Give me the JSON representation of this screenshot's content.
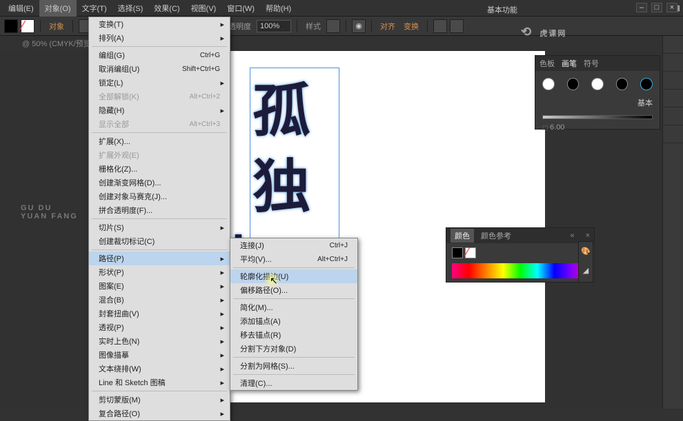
{
  "menubar": [
    "编辑(E)",
    "对象(O)",
    "文字(T)",
    "选择(S)",
    "效果(C)",
    "视图(V)",
    "窗口(W)",
    "帮助(H)"
  ],
  "menubar_active_index": 1,
  "right_header": "基本功能",
  "toolrow": {
    "obj_label": "对象",
    "basic_label": "基本",
    "opacity_label": "不透明度",
    "opacity_value": "100%",
    "style_label": "样式",
    "align_label": "对齐",
    "transform_label": "变换"
  },
  "doc_label": "@ 50% (CMYK/预览)",
  "canvas_side_text": {
    "line1": "GU DU",
    "line2": "YUAN FANG"
  },
  "dropdown": [
    {
      "type": "row",
      "label": "变换(T)",
      "arrow": true
    },
    {
      "type": "row",
      "label": "排列(A)",
      "arrow": true
    },
    {
      "type": "sep"
    },
    {
      "type": "row",
      "label": "编组(G)",
      "short": "Ctrl+G"
    },
    {
      "type": "row",
      "label": "取消编组(U)",
      "short": "Shift+Ctrl+G"
    },
    {
      "type": "row",
      "label": "锁定(L)",
      "arrow": true
    },
    {
      "type": "row",
      "label": "全部解锁(K)",
      "short": "Alt+Ctrl+2",
      "disabled": true
    },
    {
      "type": "row",
      "label": "隐藏(H)",
      "arrow": true
    },
    {
      "type": "row",
      "label": "显示全部",
      "short": "Alt+Ctrl+3",
      "disabled": true
    },
    {
      "type": "sep"
    },
    {
      "type": "row",
      "label": "扩展(X)..."
    },
    {
      "type": "row",
      "label": "扩展外观(E)",
      "disabled": true
    },
    {
      "type": "row",
      "label": "栅格化(Z)..."
    },
    {
      "type": "row",
      "label": "创建渐变网格(D)..."
    },
    {
      "type": "row",
      "label": "创建对象马赛克(J)..."
    },
    {
      "type": "row",
      "label": "拼合透明度(F)..."
    },
    {
      "type": "sep"
    },
    {
      "type": "row",
      "label": "切片(S)",
      "arrow": true
    },
    {
      "type": "row",
      "label": "创建裁切标记(C)"
    },
    {
      "type": "sep"
    },
    {
      "type": "row",
      "label": "路径(P)",
      "arrow": true,
      "hover": true
    },
    {
      "type": "row",
      "label": "形状(P)",
      "arrow": true
    },
    {
      "type": "row",
      "label": "图案(E)",
      "arrow": true
    },
    {
      "type": "row",
      "label": "混合(B)",
      "arrow": true
    },
    {
      "type": "row",
      "label": "封套扭曲(V)",
      "arrow": true
    },
    {
      "type": "row",
      "label": "透视(P)",
      "arrow": true
    },
    {
      "type": "row",
      "label": "实时上色(N)",
      "arrow": true
    },
    {
      "type": "row",
      "label": "图像描摹",
      "arrow": true
    },
    {
      "type": "row",
      "label": "文本绕排(W)",
      "arrow": true
    },
    {
      "type": "row",
      "label": "Line 和 Sketch 图稿",
      "arrow": true
    },
    {
      "type": "sep"
    },
    {
      "type": "row",
      "label": "剪切蒙版(M)",
      "arrow": true
    },
    {
      "type": "row",
      "label": "复合路径(O)",
      "arrow": true
    }
  ],
  "submenu": [
    {
      "type": "row",
      "label": "连接(J)",
      "short": "Ctrl+J"
    },
    {
      "type": "row",
      "label": "平均(V)...",
      "short": "Alt+Ctrl+J"
    },
    {
      "type": "sep"
    },
    {
      "type": "row",
      "label": "轮廓化描边(U)",
      "hover": true
    },
    {
      "type": "row",
      "label": "偏移路径(O)..."
    },
    {
      "type": "sep"
    },
    {
      "type": "row",
      "label": "简化(M)..."
    },
    {
      "type": "row",
      "label": "添加锚点(A)"
    },
    {
      "type": "row",
      "label": "移去锚点(R)"
    },
    {
      "type": "row",
      "label": "分割下方对象(D)"
    },
    {
      "type": "sep"
    },
    {
      "type": "row",
      "label": "分割为网格(S)..."
    },
    {
      "type": "sep"
    },
    {
      "type": "row",
      "label": "清理(C)..."
    }
  ],
  "panel_brush": {
    "tabs": [
      "色板",
      "画笔",
      "符号"
    ],
    "basic": "基本",
    "weight": "6.00"
  },
  "panel_color": {
    "tabs": [
      "颜色",
      "颜色参考"
    ]
  },
  "glyphs": [
    "孤",
    "独",
    "匕"
  ],
  "watermark": "虎课网"
}
